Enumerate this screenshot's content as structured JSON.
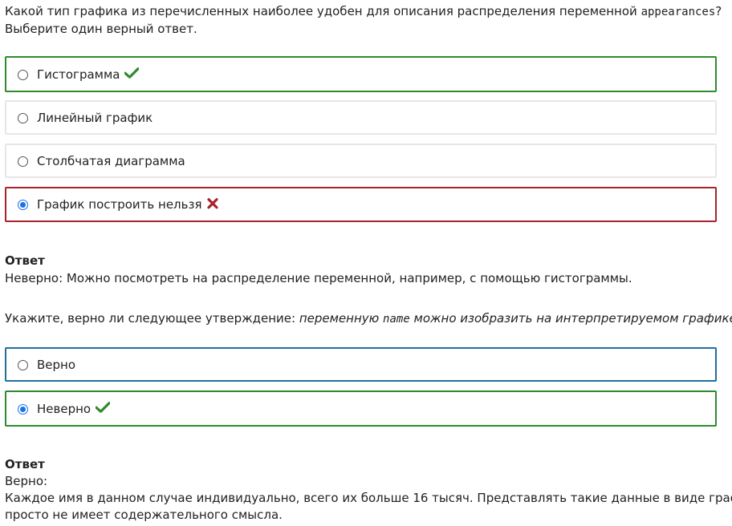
{
  "q1": {
    "text_before": "Какой тип графика из перечисленных наиболее удобен для описания распределения переменной ",
    "code": "appearances",
    "text_after": "?",
    "line2": "Выберите один верный ответ.",
    "options": [
      {
        "label": "Гистограмма",
        "checked": false,
        "state": "correct"
      },
      {
        "label": "Линейный график",
        "checked": false,
        "state": "none"
      },
      {
        "label": "Столбчатая диаграмма",
        "checked": false,
        "state": "none"
      },
      {
        "label": "График построить нельзя",
        "checked": true,
        "state": "wrong"
      }
    ],
    "answer_title": "Ответ",
    "answer_text": "Неверно:  Можно посмотреть на распределение переменной, например, с помощью гистограммы."
  },
  "q2": {
    "text_prefix": "Укажите, верно ли следующее утверждение: ",
    "em_before": "переменную ",
    "code": "name",
    "em_after": " можно изобразить на интерпретируемом графике",
    "period": ".",
    "options": [
      {
        "label": "Верно",
        "checked": false,
        "state": "focus"
      },
      {
        "label": "Неверно",
        "checked": true,
        "state": "correct"
      }
    ],
    "answer_title": "Ответ",
    "answer_line1": "Верно:",
    "answer_line2": "Каждое имя в данном случае индивидуально, всего их больше 16 тысяч. Представлять такие данные в виде графика",
    "answer_line3": "просто не имеет содержательного смысла."
  },
  "colors": {
    "correct": "#2e8b2e",
    "wrong": "#a8232d",
    "focus": "#1f6f9f",
    "radio_checked": "#1a73e8"
  },
  "icons": {
    "correct": "check-icon",
    "wrong": "cross-icon"
  }
}
